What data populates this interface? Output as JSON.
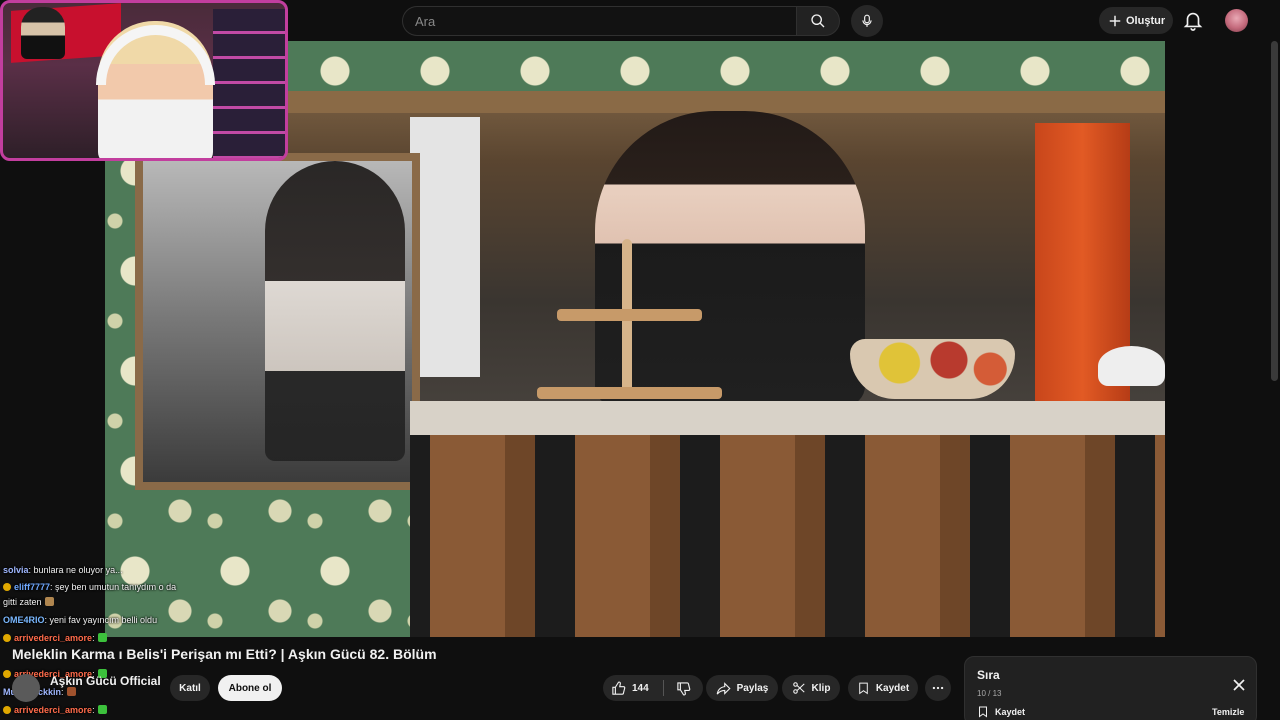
{
  "search": {
    "placeholder": "Ara"
  },
  "header": {
    "create_label": "Oluştur"
  },
  "video": {
    "title": "Meleklin Karma ı Belis'i Perişan mı Etti? | Aşkın Gücü 82. Bölüm",
    "channel": "Aşkın Gücü Official",
    "subs": "",
    "join_label": "Katıl",
    "subscribe_label": "Abone ol",
    "likes": "144",
    "share_label": "Paylaş",
    "clip_label": "Klip",
    "save_label": "Kaydet"
  },
  "chat": [
    {
      "user": "solvia",
      "text": ": bunlara ne oluyor ya...",
      "color": "#9fb7ff"
    },
    {
      "user": "eliff7777",
      "text": ": şey ben umutun tanıydım o da",
      "color": "#6fa8ff"
    },
    {
      "user": "",
      "text": "gitti zaten",
      "color": "#ffffff"
    },
    {
      "user": "OME4RIO",
      "text": ": yeni fav yayıncım belli oldu",
      "color": "#7ab8ff"
    },
    {
      "user": "arrivederci_amore",
      "text": ":",
      "color": "#ff6b4a"
    },
    {
      "user": "arrivederci_amore",
      "text": ":",
      "color": "#ff6b4a"
    },
    {
      "user": "Multithuckkin",
      "text": ":",
      "color": "#9fb7ff"
    },
    {
      "user": "arrivederci_amore",
      "text": ":",
      "color": "#ff6b4a"
    }
  ],
  "queue": {
    "title": "Sıra",
    "count": "10 / 13",
    "save_label": "Kaydet",
    "clear_label": "Temizle"
  },
  "colors": {
    "accent": "#c23e9e",
    "background": "#0f0f0f"
  }
}
